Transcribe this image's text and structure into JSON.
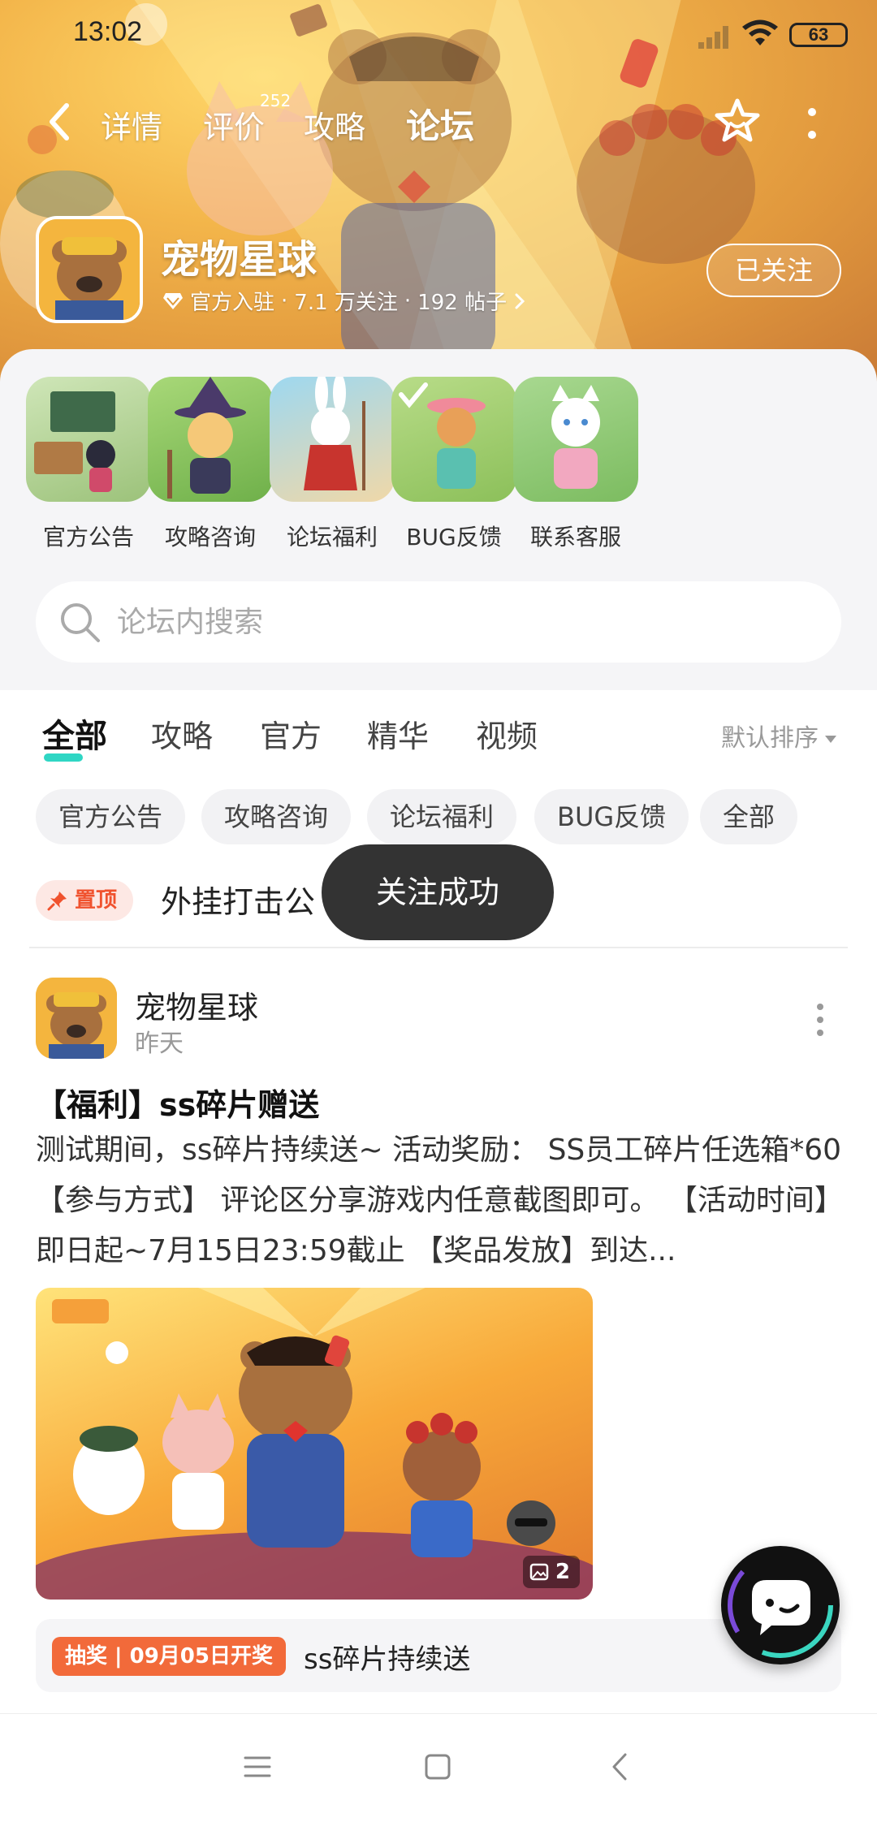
{
  "status_bar": {
    "time": "13:02",
    "battery": "63"
  },
  "nav": {
    "tabs": [
      {
        "label": "详情"
      },
      {
        "label": "评价"
      },
      {
        "label": "攻略"
      },
      {
        "label": "论坛"
      }
    ],
    "review_count": "252",
    "active_tab": "论坛"
  },
  "game": {
    "name": "宠物星球",
    "official": "官方入驻",
    "followers": "7.1 万关注",
    "posts": "192 帖子",
    "follow_label": "已关注"
  },
  "shortcuts": [
    {
      "label": "官方公告"
    },
    {
      "label": "攻略咨询"
    },
    {
      "label": "论坛福利"
    },
    {
      "label": "BUG反馈"
    },
    {
      "label": "联系客服"
    }
  ],
  "search": {
    "placeholder": "论坛内搜索"
  },
  "feed_tabs": [
    {
      "label": "全部"
    },
    {
      "label": "攻略"
    },
    {
      "label": "官方"
    },
    {
      "label": "精华"
    },
    {
      "label": "视频"
    }
  ],
  "sort_label": "默认排序",
  "chips": [
    {
      "label": "官方公告"
    },
    {
      "label": "攻略咨询"
    },
    {
      "label": "论坛福利"
    },
    {
      "label": "BUG反馈"
    },
    {
      "label": "全部"
    }
  ],
  "pinned": {
    "badge": "置顶",
    "text": "外挂打击公"
  },
  "toast": "关注成功",
  "post": {
    "author": "宠物星球",
    "time": "昨天",
    "title": "【福利】ss碎片赠送",
    "body": "测试期间，ss碎片持续送~ 活动奖励： SS员工碎片任选箱*60 【参与方式】 评论区分享游戏内任意截图即可。 【活动时间】即日起~7月15日23:59截止 【奖品发放】到达...",
    "image_count": "2",
    "image_logo": "宠物星球",
    "lottery_tag": "抽奖 | 09月05日开奖",
    "lottery_text": "ss碎片持续送"
  },
  "colors": {
    "accent": "#2fd6c4",
    "pin_red": "#f0522e",
    "lottery_orange": "#f26a3a",
    "toast_bg": "#333333"
  }
}
